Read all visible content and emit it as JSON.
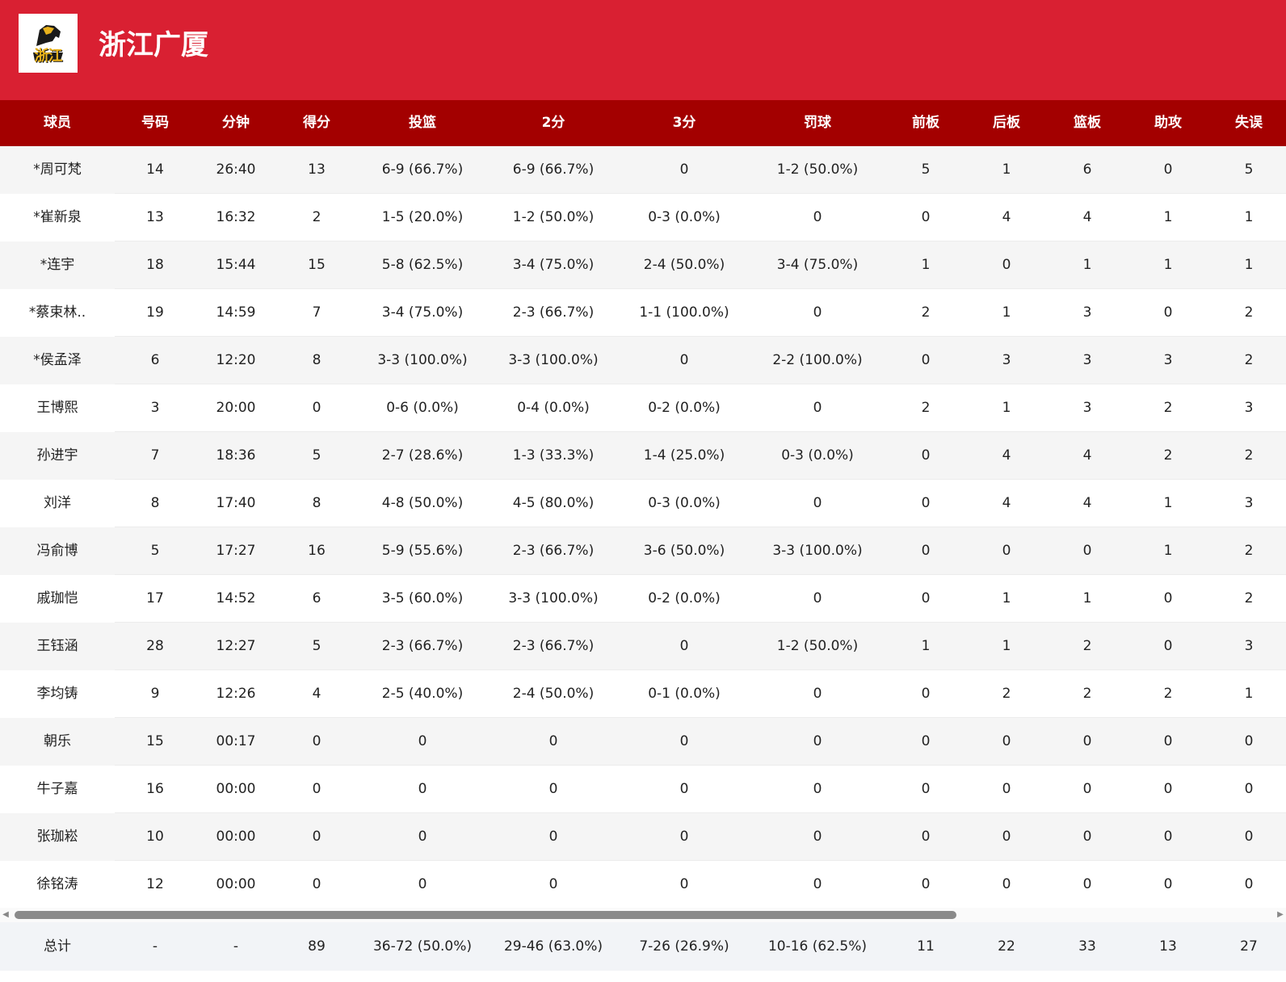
{
  "team": {
    "name": "浙江广厦",
    "logo_text": "浙江",
    "logo_icon": "lion-logo-icon",
    "colors": {
      "header": "#d92032",
      "table_header": "#a30000",
      "logo_gold": "#e8b21c"
    }
  },
  "columns": [
    "球员",
    "号码",
    "分钟",
    "得分",
    "投篮",
    "2分",
    "3分",
    "罚球",
    "前板",
    "后板",
    "篮板",
    "助攻",
    "失误"
  ],
  "rows": [
    [
      "*周可梵",
      "14",
      "26:40",
      "13",
      "6-9 (66.7%)",
      "6-9 (66.7%)",
      "0",
      "1-2 (50.0%)",
      "5",
      "1",
      "6",
      "0",
      "5"
    ],
    [
      "*崔新泉",
      "13",
      "16:32",
      "2",
      "1-5 (20.0%)",
      "1-2 (50.0%)",
      "0-3 (0.0%)",
      "0",
      "0",
      "4",
      "4",
      "1",
      "1"
    ],
    [
      "*连宇",
      "18",
      "15:44",
      "15",
      "5-8 (62.5%)",
      "3-4 (75.0%)",
      "2-4 (50.0%)",
      "3-4 (75.0%)",
      "1",
      "0",
      "1",
      "1",
      "1"
    ],
    [
      "*蔡束林..",
      "19",
      "14:59",
      "7",
      "3-4 (75.0%)",
      "2-3 (66.7%)",
      "1-1 (100.0%)",
      "0",
      "2",
      "1",
      "3",
      "0",
      "2"
    ],
    [
      "*侯孟泽",
      "6",
      "12:20",
      "8",
      "3-3 (100.0%)",
      "3-3 (100.0%)",
      "0",
      "2-2 (100.0%)",
      "0",
      "3",
      "3",
      "3",
      "2"
    ],
    [
      "王博熙",
      "3",
      "20:00",
      "0",
      "0-6 (0.0%)",
      "0-4 (0.0%)",
      "0-2 (0.0%)",
      "0",
      "2",
      "1",
      "3",
      "2",
      "3"
    ],
    [
      "孙进宇",
      "7",
      "18:36",
      "5",
      "2-7 (28.6%)",
      "1-3 (33.3%)",
      "1-4 (25.0%)",
      "0-3 (0.0%)",
      "0",
      "4",
      "4",
      "2",
      "2"
    ],
    [
      "刘洋",
      "8",
      "17:40",
      "8",
      "4-8 (50.0%)",
      "4-5 (80.0%)",
      "0-3 (0.0%)",
      "0",
      "0",
      "4",
      "4",
      "1",
      "3"
    ],
    [
      "冯俞博",
      "5",
      "17:27",
      "16",
      "5-9 (55.6%)",
      "2-3 (66.7%)",
      "3-6 (50.0%)",
      "3-3 (100.0%)",
      "0",
      "0",
      "0",
      "1",
      "2"
    ],
    [
      "戚珈恺",
      "17",
      "14:52",
      "6",
      "3-5 (60.0%)",
      "3-3 (100.0%)",
      "0-2 (0.0%)",
      "0",
      "0",
      "1",
      "1",
      "0",
      "2"
    ],
    [
      "王钰涵",
      "28",
      "12:27",
      "5",
      "2-3 (66.7%)",
      "2-3 (66.7%)",
      "0",
      "1-2 (50.0%)",
      "1",
      "1",
      "2",
      "0",
      "3"
    ],
    [
      "李均铸",
      "9",
      "12:26",
      "4",
      "2-5 (40.0%)",
      "2-4 (50.0%)",
      "0-1 (0.0%)",
      "0",
      "0",
      "2",
      "2",
      "2",
      "1"
    ],
    [
      "朝乐",
      "15",
      "00:17",
      "0",
      "0",
      "0",
      "0",
      "0",
      "0",
      "0",
      "0",
      "0",
      "0"
    ],
    [
      "牛子嘉",
      "16",
      "00:00",
      "0",
      "0",
      "0",
      "0",
      "0",
      "0",
      "0",
      "0",
      "0",
      "0"
    ],
    [
      "张珈崧",
      "10",
      "00:00",
      "0",
      "0",
      "0",
      "0",
      "0",
      "0",
      "0",
      "0",
      "0",
      "0"
    ],
    [
      "徐铭涛",
      "12",
      "00:00",
      "0",
      "0",
      "0",
      "0",
      "0",
      "0",
      "0",
      "0",
      "0",
      "0"
    ]
  ],
  "totals": [
    "总计",
    "-",
    "-",
    "89",
    "36-72 (50.0%)",
    "29-46 (63.0%)",
    "7-26 (26.9%)",
    "10-16 (62.5%)",
    "11",
    "22",
    "33",
    "13",
    "27"
  ],
  "scrollbar": {
    "left_icon": "scroll-left-arrow-icon",
    "right_icon": "scroll-right-arrow-icon"
  }
}
